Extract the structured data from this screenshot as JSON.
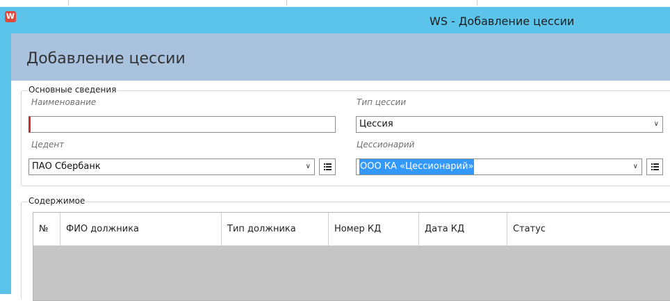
{
  "window": {
    "title": "WS - Добавление цессии",
    "app_icon_letter": "W",
    "accent_color": "#5cc4ea",
    "header_color": "#a9c3df"
  },
  "page": {
    "title": "Добавление цессии"
  },
  "main_section": {
    "legend": "Основные сведения",
    "name_label": "Наименование",
    "name_value": "",
    "type_label": "Тип цессии",
    "type_value": "Цессия",
    "cedent_label": "Цедент",
    "cedent_value": "ПАО Сбербанк",
    "cessionary_label": "Цессионарий",
    "cessionary_value": "ООО КА «Цессионарий»"
  },
  "content_section": {
    "legend": "Содержимое",
    "columns": [
      "№",
      "ФИО должника",
      "Тип должника",
      "Номер КД",
      "Дата КД",
      "Статус"
    ],
    "rows": []
  },
  "icons": {
    "dropdown": "chevron-down-icon",
    "list": "list-icon"
  }
}
